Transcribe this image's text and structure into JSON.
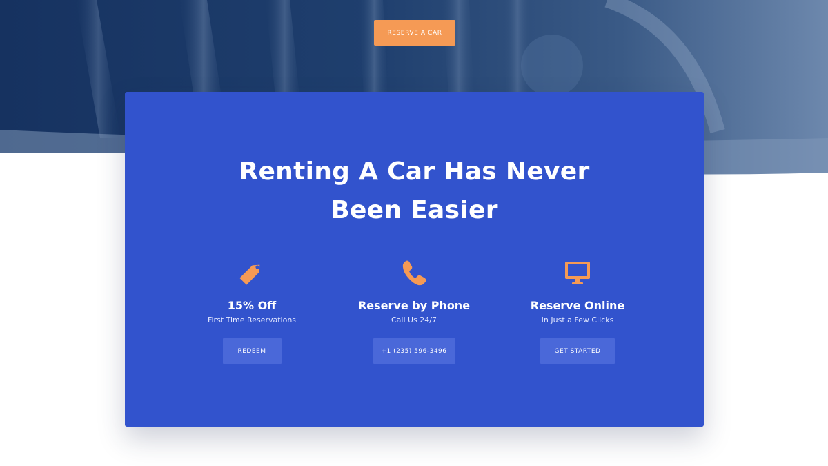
{
  "hero": {
    "cta_label": "RESERVE A CAR"
  },
  "card": {
    "headline_line1": "Renting A Car Has Never",
    "headline_line2": "Been Easier",
    "features": [
      {
        "icon": "tag-icon",
        "title": "15% Off",
        "subtitle": "First Time Reservations",
        "button_label": "REDEEM"
      },
      {
        "icon": "phone-icon",
        "title": "Reserve by Phone",
        "subtitle": "Call Us 24/7",
        "button_label": "+1 (235) 596-3496"
      },
      {
        "icon": "monitor-icon",
        "title": "Reserve Online",
        "subtitle": "In Just a Few Clicks",
        "button_label": "GET STARTED"
      }
    ]
  },
  "colors": {
    "card_background": "#3253cd",
    "accent_orange": "#f59a55",
    "hero_dark_blue": "#1d3a66",
    "button_background": "#4a68d9"
  }
}
